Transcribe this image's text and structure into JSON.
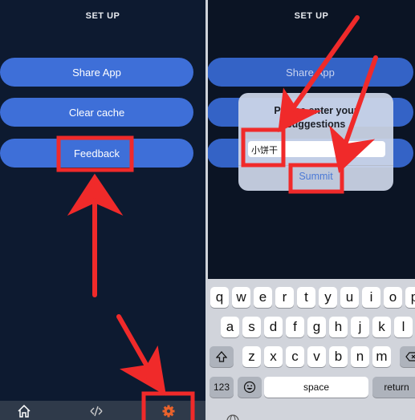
{
  "left": {
    "title": "SET UP",
    "buttons": [
      "Share App",
      "Clear cache",
      "Feedback"
    ],
    "tabs": [
      {
        "icon": "home-icon"
      },
      {
        "icon": "share-arrows-icon"
      },
      {
        "icon": "gear-icon",
        "active": true,
        "color": "#e8622c"
      }
    ]
  },
  "right": {
    "title": "SET UP",
    "buttons": [
      "Share App"
    ],
    "dialog": {
      "title_line1": "Please enter your",
      "title_line2": "suggestions",
      "input_value": "小饼干",
      "submit_label": "Summit"
    },
    "keyboard": {
      "row1": [
        "q",
        "w",
        "e",
        "r",
        "t",
        "y",
        "u",
        "i",
        "o",
        "p"
      ],
      "row2": [
        "a",
        "s",
        "d",
        "f",
        "g",
        "h",
        "j",
        "k",
        "l"
      ],
      "row3": [
        "z",
        "x",
        "c",
        "v",
        "b",
        "n",
        "m"
      ],
      "numbers_label": "123",
      "space_label": "space",
      "return_label": "return"
    }
  },
  "colors": {
    "highlight": "#f02a2a",
    "button": "#3e6fd8",
    "background": "#0d1a30"
  }
}
